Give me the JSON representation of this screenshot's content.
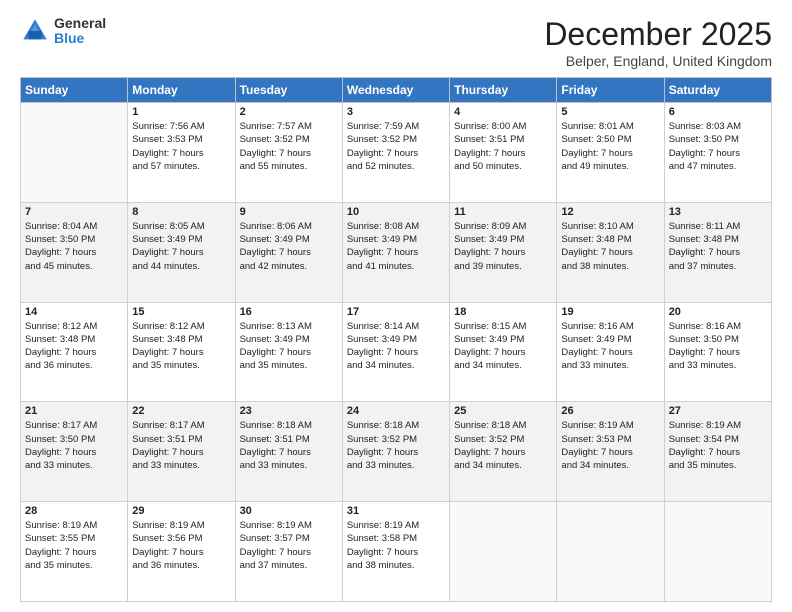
{
  "logo": {
    "general": "General",
    "blue": "Blue"
  },
  "title": "December 2025",
  "location": "Belper, England, United Kingdom",
  "days_of_week": [
    "Sunday",
    "Monday",
    "Tuesday",
    "Wednesday",
    "Thursday",
    "Friday",
    "Saturday"
  ],
  "weeks": [
    [
      {
        "day": "",
        "sunrise": "",
        "sunset": "",
        "daylight": ""
      },
      {
        "day": "1",
        "sunrise": "Sunrise: 7:56 AM",
        "sunset": "Sunset: 3:53 PM",
        "daylight": "Daylight: 7 hours and 57 minutes."
      },
      {
        "day": "2",
        "sunrise": "Sunrise: 7:57 AM",
        "sunset": "Sunset: 3:52 PM",
        "daylight": "Daylight: 7 hours and 55 minutes."
      },
      {
        "day": "3",
        "sunrise": "Sunrise: 7:59 AM",
        "sunset": "Sunset: 3:52 PM",
        "daylight": "Daylight: 7 hours and 52 minutes."
      },
      {
        "day": "4",
        "sunrise": "Sunrise: 8:00 AM",
        "sunset": "Sunset: 3:51 PM",
        "daylight": "Daylight: 7 hours and 50 minutes."
      },
      {
        "day": "5",
        "sunrise": "Sunrise: 8:01 AM",
        "sunset": "Sunset: 3:50 PM",
        "daylight": "Daylight: 7 hours and 49 minutes."
      },
      {
        "day": "6",
        "sunrise": "Sunrise: 8:03 AM",
        "sunset": "Sunset: 3:50 PM",
        "daylight": "Daylight: 7 hours and 47 minutes."
      }
    ],
    [
      {
        "day": "7",
        "sunrise": "Sunrise: 8:04 AM",
        "sunset": "Sunset: 3:50 PM",
        "daylight": "Daylight: 7 hours and 45 minutes."
      },
      {
        "day": "8",
        "sunrise": "Sunrise: 8:05 AM",
        "sunset": "Sunset: 3:49 PM",
        "daylight": "Daylight: 7 hours and 44 minutes."
      },
      {
        "day": "9",
        "sunrise": "Sunrise: 8:06 AM",
        "sunset": "Sunset: 3:49 PM",
        "daylight": "Daylight: 7 hours and 42 minutes."
      },
      {
        "day": "10",
        "sunrise": "Sunrise: 8:08 AM",
        "sunset": "Sunset: 3:49 PM",
        "daylight": "Daylight: 7 hours and 41 minutes."
      },
      {
        "day": "11",
        "sunrise": "Sunrise: 8:09 AM",
        "sunset": "Sunset: 3:49 PM",
        "daylight": "Daylight: 7 hours and 39 minutes."
      },
      {
        "day": "12",
        "sunrise": "Sunrise: 8:10 AM",
        "sunset": "Sunset: 3:48 PM",
        "daylight": "Daylight: 7 hours and 38 minutes."
      },
      {
        "day": "13",
        "sunrise": "Sunrise: 8:11 AM",
        "sunset": "Sunset: 3:48 PM",
        "daylight": "Daylight: 7 hours and 37 minutes."
      }
    ],
    [
      {
        "day": "14",
        "sunrise": "Sunrise: 8:12 AM",
        "sunset": "Sunset: 3:48 PM",
        "daylight": "Daylight: 7 hours and 36 minutes."
      },
      {
        "day": "15",
        "sunrise": "Sunrise: 8:12 AM",
        "sunset": "Sunset: 3:48 PM",
        "daylight": "Daylight: 7 hours and 35 minutes."
      },
      {
        "day": "16",
        "sunrise": "Sunrise: 8:13 AM",
        "sunset": "Sunset: 3:49 PM",
        "daylight": "Daylight: 7 hours and 35 minutes."
      },
      {
        "day": "17",
        "sunrise": "Sunrise: 8:14 AM",
        "sunset": "Sunset: 3:49 PM",
        "daylight": "Daylight: 7 hours and 34 minutes."
      },
      {
        "day": "18",
        "sunrise": "Sunrise: 8:15 AM",
        "sunset": "Sunset: 3:49 PM",
        "daylight": "Daylight: 7 hours and 34 minutes."
      },
      {
        "day": "19",
        "sunrise": "Sunrise: 8:16 AM",
        "sunset": "Sunset: 3:49 PM",
        "daylight": "Daylight: 7 hours and 33 minutes."
      },
      {
        "day": "20",
        "sunrise": "Sunrise: 8:16 AM",
        "sunset": "Sunset: 3:50 PM",
        "daylight": "Daylight: 7 hours and 33 minutes."
      }
    ],
    [
      {
        "day": "21",
        "sunrise": "Sunrise: 8:17 AM",
        "sunset": "Sunset: 3:50 PM",
        "daylight": "Daylight: 7 hours and 33 minutes."
      },
      {
        "day": "22",
        "sunrise": "Sunrise: 8:17 AM",
        "sunset": "Sunset: 3:51 PM",
        "daylight": "Daylight: 7 hours and 33 minutes."
      },
      {
        "day": "23",
        "sunrise": "Sunrise: 8:18 AM",
        "sunset": "Sunset: 3:51 PM",
        "daylight": "Daylight: 7 hours and 33 minutes."
      },
      {
        "day": "24",
        "sunrise": "Sunrise: 8:18 AM",
        "sunset": "Sunset: 3:52 PM",
        "daylight": "Daylight: 7 hours and 33 minutes."
      },
      {
        "day": "25",
        "sunrise": "Sunrise: 8:18 AM",
        "sunset": "Sunset: 3:52 PM",
        "daylight": "Daylight: 7 hours and 34 minutes."
      },
      {
        "day": "26",
        "sunrise": "Sunrise: 8:19 AM",
        "sunset": "Sunset: 3:53 PM",
        "daylight": "Daylight: 7 hours and 34 minutes."
      },
      {
        "day": "27",
        "sunrise": "Sunrise: 8:19 AM",
        "sunset": "Sunset: 3:54 PM",
        "daylight": "Daylight: 7 hours and 35 minutes."
      }
    ],
    [
      {
        "day": "28",
        "sunrise": "Sunrise: 8:19 AM",
        "sunset": "Sunset: 3:55 PM",
        "daylight": "Daylight: 7 hours and 35 minutes."
      },
      {
        "day": "29",
        "sunrise": "Sunrise: 8:19 AM",
        "sunset": "Sunset: 3:56 PM",
        "daylight": "Daylight: 7 hours and 36 minutes."
      },
      {
        "day": "30",
        "sunrise": "Sunrise: 8:19 AM",
        "sunset": "Sunset: 3:57 PM",
        "daylight": "Daylight: 7 hours and 37 minutes."
      },
      {
        "day": "31",
        "sunrise": "Sunrise: 8:19 AM",
        "sunset": "Sunset: 3:58 PM",
        "daylight": "Daylight: 7 hours and 38 minutes."
      },
      {
        "day": "",
        "sunrise": "",
        "sunset": "",
        "daylight": ""
      },
      {
        "day": "",
        "sunrise": "",
        "sunset": "",
        "daylight": ""
      },
      {
        "day": "",
        "sunrise": "",
        "sunset": "",
        "daylight": ""
      }
    ]
  ]
}
